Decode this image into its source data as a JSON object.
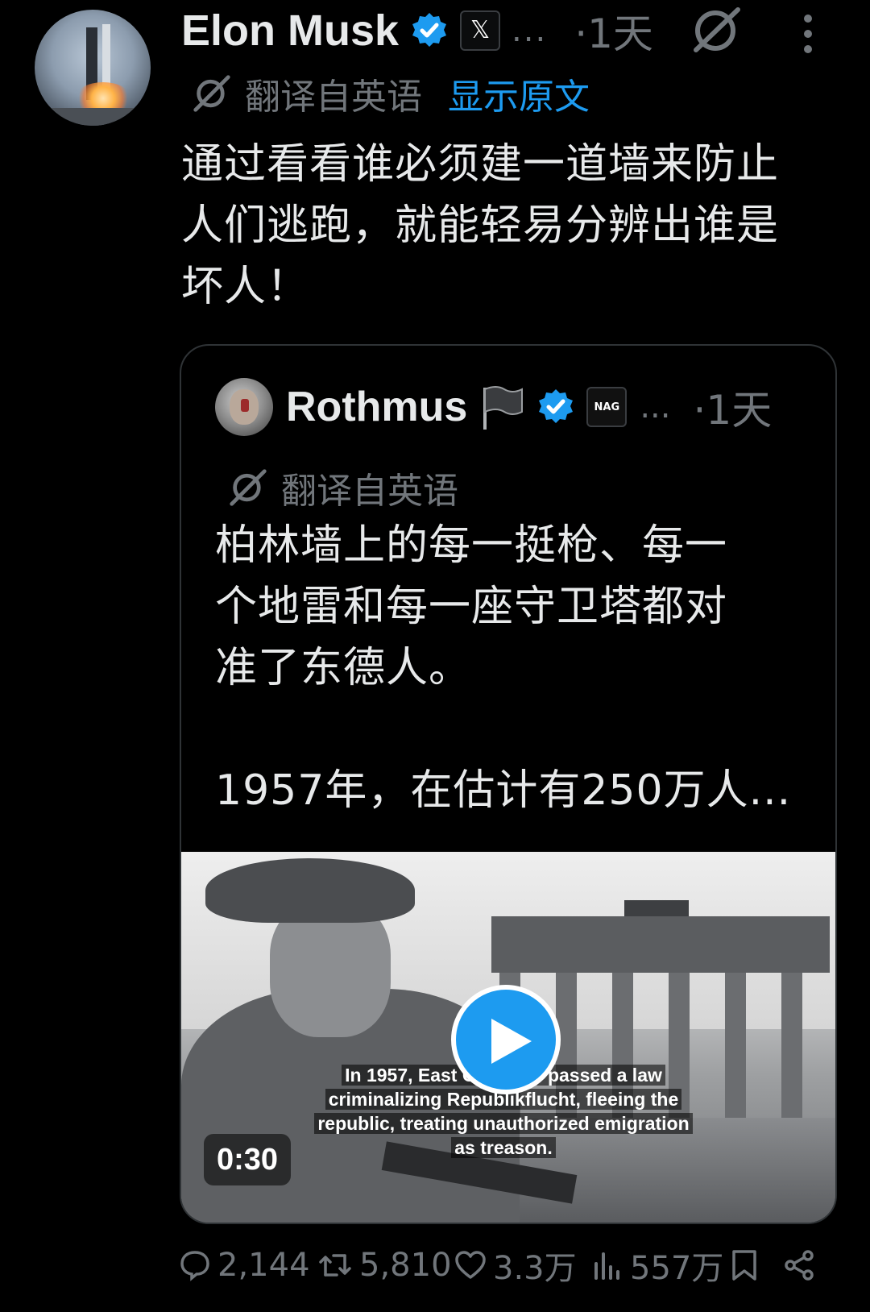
{
  "post": {
    "author": "Elon Musk",
    "more": "...",
    "time": "·1天",
    "translated_from": "翻译自英语",
    "show_original": "显示原文",
    "text_lines": [
      "通过看看谁必须建一道墙来防止",
      "人们逃跑，就能轻易分辨出谁是",
      "坏人！"
    ]
  },
  "quote": {
    "author": "Rothmus",
    "badge_text": "NAG",
    "more": "...",
    "time": "·1天",
    "translated_from": "翻译自英语",
    "paragraph1_lines": [
      "柏林墙上的每一挺枪、每一",
      "个地雷和每一座守卫塔都对",
      "准了东德人。"
    ],
    "paragraph2": "1957年，在估计有250万人...",
    "video": {
      "caption_lines": [
        "In 1957, East Germany passed a law",
        "criminalizing Republikflucht, fleeing the",
        "republic, treating unauthorized emigration",
        "as treason."
      ],
      "duration": "0:30"
    }
  },
  "actions": {
    "replies": "2,144",
    "reposts": "5,810",
    "likes": "3.3万",
    "views": "557万"
  },
  "colors": {
    "background": "#000000",
    "text": "#e7e9ea",
    "muted": "#71767b",
    "accent": "#1d9bf0"
  }
}
